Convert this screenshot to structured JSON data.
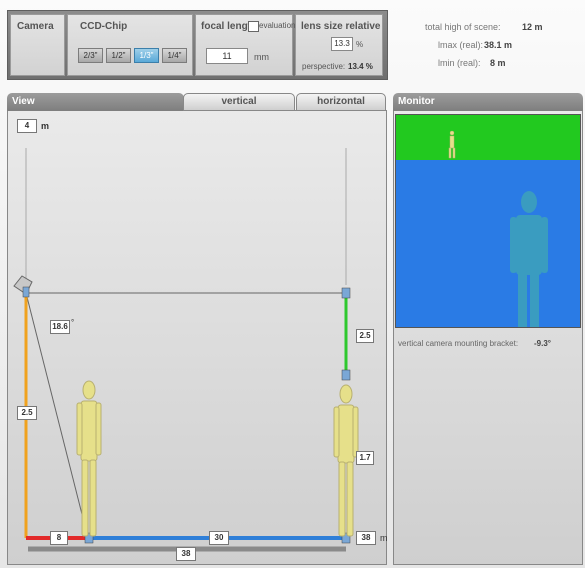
{
  "toolbar": {
    "camera_label": "Camera",
    "ccd_label": "CCD-Chip",
    "chips": [
      "2/3\"",
      "1/2\"",
      "1/3\"",
      "1/4\""
    ],
    "selected_chip": "1/3\"",
    "focal_label": "focal length",
    "evaluation_label": "evaluation",
    "focal_value": "11",
    "focal_unit": "mm",
    "lens_label": "lens size relative",
    "lens_value": "13.3",
    "lens_unit": "%",
    "perspective_label": "perspective:",
    "perspective_value": "13.4 %"
  },
  "scene_info": {
    "total_label": "total high of scene:",
    "total_value": "12 m",
    "imax_label": "lmax (real):",
    "imax_value": "38.1 m",
    "imin_label": "lmin (real):",
    "imin_value": "8 m"
  },
  "view": {
    "title": "View",
    "tab_vertical": "vertical",
    "tab_horizontal": "horizontal",
    "height_value": "4",
    "height_unit": "m",
    "angle_value": "18.6",
    "angle_unit": "°",
    "camera_height": "2.5",
    "target_cam_gap": "2.5",
    "person_height": "1.7",
    "dist_red": "8",
    "dist_blue": "30",
    "dist_total_grey": "38",
    "dist_field": "38",
    "dist_field_unit": "m"
  },
  "monitor": {
    "title": "Monitor",
    "bracket_label": "vertical camera mounting bracket:",
    "bracket_value": "-9.3°"
  },
  "colors": {
    "orange": "#f0a21e",
    "red": "#e22a2a",
    "blue": "#2f7fd8",
    "green": "#2ec82e",
    "monitor_sky": "#22c91f",
    "monitor_ground": "#2a7be5",
    "person": "#e6e08a"
  }
}
